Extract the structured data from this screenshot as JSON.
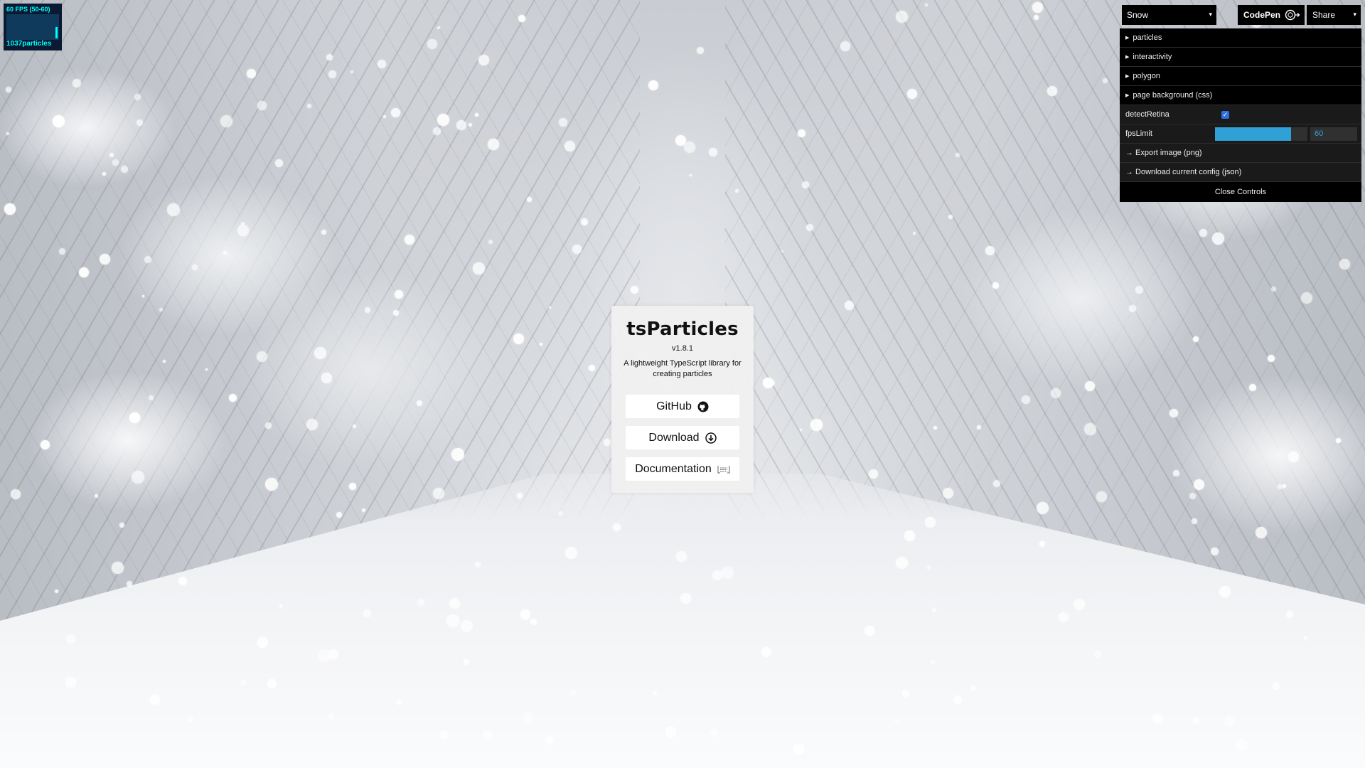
{
  "fps_meter": {
    "fps_label": "60 FPS (50-60)",
    "particles_label": "1037particles"
  },
  "card": {
    "title": "tsParticles",
    "version": "v1.8.1",
    "description": "A lightweight TypeScript library for creating particles",
    "buttons": {
      "github": "GitHub",
      "download": "Download",
      "documentation": "Documentation"
    }
  },
  "toolbar": {
    "preset_selected": "Snow",
    "codepen_label": "CodePen",
    "share_label": "Share"
  },
  "gui": {
    "folders": [
      "particles",
      "interactivity",
      "polygon",
      "page background (css)"
    ],
    "detect_retina_label": "detectRetina",
    "detect_retina_checked": true,
    "fps_limit_label": "fpsLimit",
    "fps_limit_value": "60",
    "fps_limit_fill_fraction": 0.82,
    "export_image_label": "→ Export image (png)",
    "download_config_label": "→ Download current config (json)",
    "close_label": "Close Controls"
  },
  "colors": {
    "fps_text": "#00ffff",
    "slider_fill": "#2fa1d6",
    "checkbox": "#2f6fe0",
    "panel_bg": "#1a1a1a"
  },
  "icons": [
    "github-icon",
    "download-icon",
    "api-icon",
    "codepen-icon"
  ]
}
